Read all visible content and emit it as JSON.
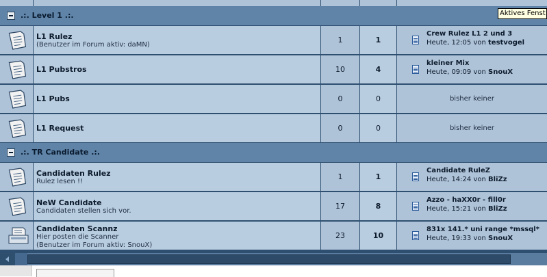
{
  "tooltip": "Aktives Fenst",
  "categories": [
    {
      "title": ".:. Level 1 .:."
    },
    {
      "title": ".:. TR Candidate .:."
    }
  ],
  "forums": [
    {
      "name": "L1 Rulez",
      "desc": "(Benutzer im Forum aktiv: daMN)",
      "desc2": "",
      "topics": "1",
      "posts": "1",
      "last": {
        "title": "Crew Rulez L1 2 und 3",
        "time": "Heute, 12:05",
        "by": "von",
        "user": "testvogel"
      }
    },
    {
      "name": "L1 Pubstros",
      "desc": "",
      "desc2": "",
      "topics": "10",
      "posts": "4",
      "last": {
        "title": "kleiner Mix",
        "time": "Heute, 09:09",
        "by": "von",
        "user": "SnouX"
      }
    },
    {
      "name": "L1 Pubs",
      "desc": "",
      "desc2": "",
      "topics": "0",
      "posts": "0",
      "none": "bisher keiner"
    },
    {
      "name": "L1 Request",
      "desc": "",
      "desc2": "",
      "topics": "0",
      "posts": "0",
      "none": "bisher keiner"
    },
    {
      "name": "Candidaten Rulez",
      "desc": "Rulez lesen !!",
      "desc2": "",
      "topics": "1",
      "posts": "1",
      "last": {
        "title": "Candidate RuleZ",
        "time": "Heute, 14:24",
        "by": "von",
        "user": "BliZz"
      }
    },
    {
      "name": "NeW Candidate",
      "desc": "Candidaten stellen sich vor.",
      "desc2": "",
      "topics": "17",
      "posts": "8",
      "last": {
        "title": "Azzo - haXX0r - fill0r",
        "time": "Heute, 15:21",
        "by": "von",
        "user": "BliZz"
      }
    },
    {
      "name": "Candidaten Scannz",
      "desc": "Hier posten die Scanner",
      "desc2": "(Benutzer im Forum aktiv: SnouX)",
      "topics": "23",
      "posts": "10",
      "last": {
        "title": "831x 141.* uni range *mssql*",
        "time": "Heute, 19:33",
        "by": "von",
        "user": "SnouX"
      }
    }
  ],
  "icons": {
    "forum": "document-icon",
    "scanner": "scanner-icon",
    "lastpost": "post-icon",
    "collapse": "collapse-icon"
  }
}
